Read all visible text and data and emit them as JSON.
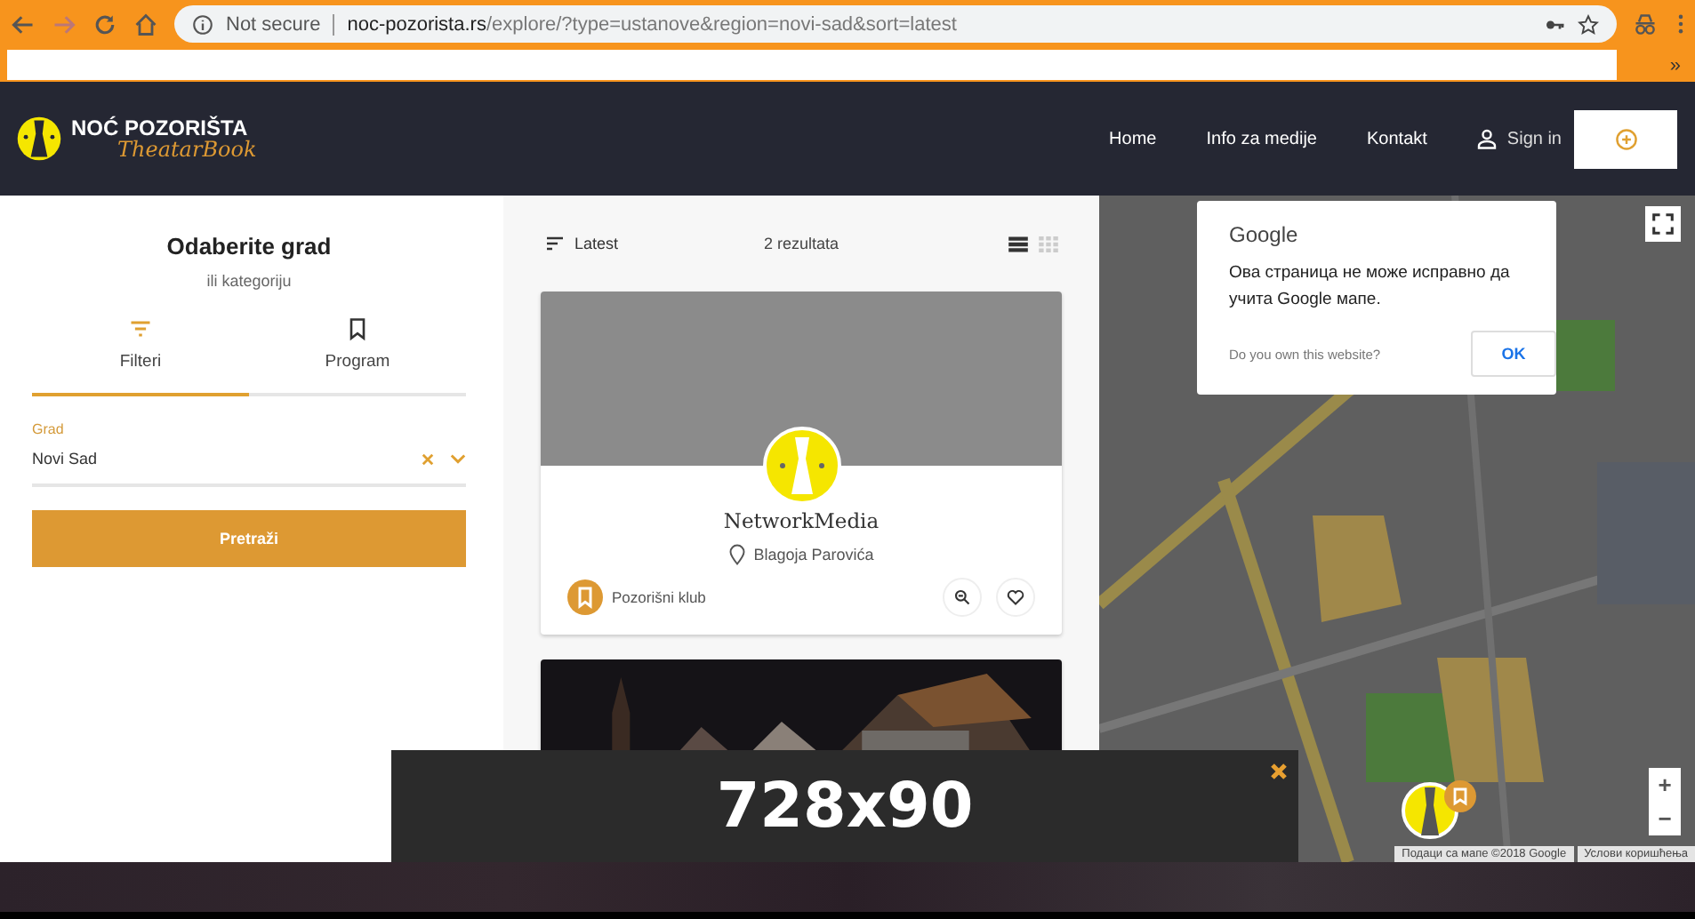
{
  "browser": {
    "security": "Not secure",
    "url_host": "noc-pozorista.rs",
    "url_path": "/explore/?type=ustanove&region=novi-sad&sort=latest",
    "bookmarks_more": "»"
  },
  "site": {
    "logo_title": "NOĆ POZORIŠTA",
    "logo_script": "TheatarBook",
    "nav": [
      "Home",
      "Info za medije",
      "Kontakt"
    ],
    "sign_in": "Sign in"
  },
  "filters": {
    "title": "Odaberite grad",
    "subtitle": "ili kategoriju",
    "tabs": [
      {
        "label": "Filteri",
        "kind": "filter",
        "selected": true
      },
      {
        "label": "Program",
        "kind": "bookmark",
        "selected": false
      }
    ],
    "field_label": "Grad",
    "field_value": "Novi Sad",
    "button": "Pretraži"
  },
  "results": {
    "sort": "Latest",
    "count": "2 rezultata",
    "views": [
      {
        "kind": "list",
        "selected": true
      },
      {
        "kind": "grid",
        "selected": false
      }
    ],
    "cards": [
      {
        "kind": "venue",
        "name": "NetworkMedia",
        "address": "Blagoja Parovića",
        "category": "Pozorišni klub"
      },
      {
        "kind": "picture"
      }
    ]
  },
  "map": {
    "dialog": {
      "brand": "Google",
      "message": "Ова страница не може исправно да учита Google мапе.",
      "question": "Do you own this website?",
      "ok": "OK"
    },
    "zoom_in": "+",
    "zoom_out": "−",
    "attribution": [
      "Подаци са мапе ©2018 Google",
      "Услови коришћења"
    ]
  },
  "ad": {
    "label": "728x90"
  }
}
